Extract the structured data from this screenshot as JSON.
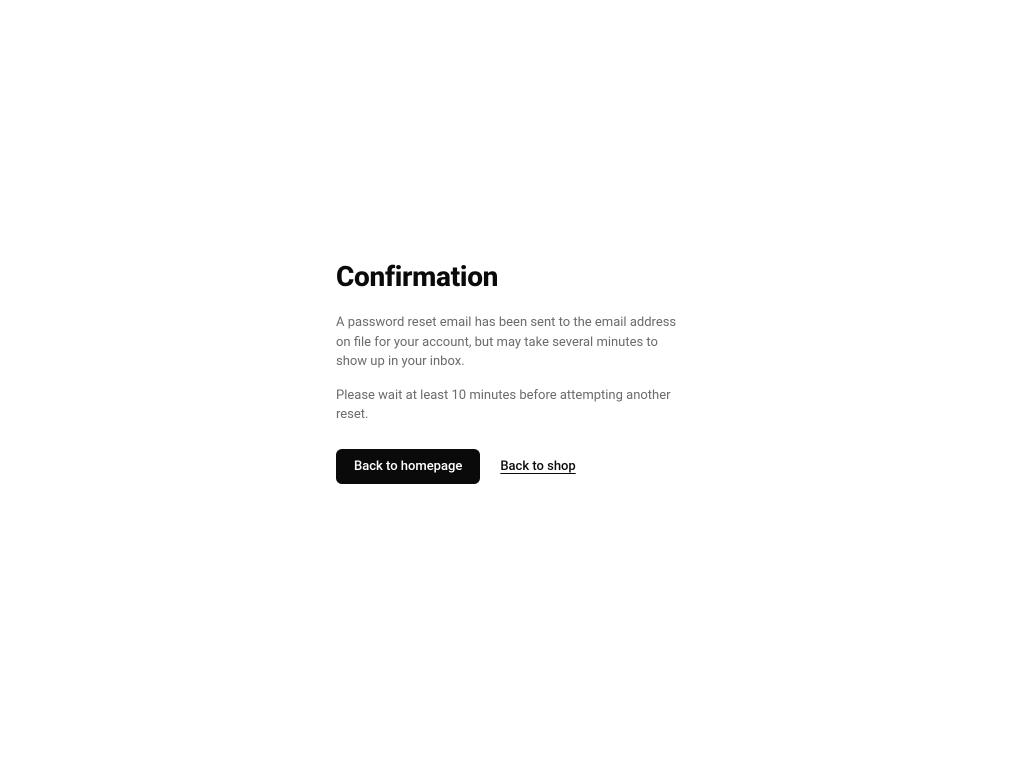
{
  "confirmation": {
    "title": "Confirmation",
    "message1": "A password reset email has been sent to the email address on file for your account, but may take several minutes to show up in your inbox.",
    "message2": "Please wait at least 10 minutes before attempting another reset.",
    "actions": {
      "primary": "Back to homepage",
      "secondary": "Back to shop"
    }
  }
}
